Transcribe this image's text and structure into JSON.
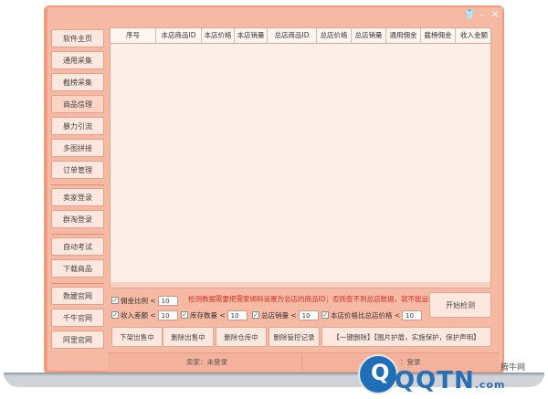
{
  "window": {
    "controls": [
      "👕",
      "–",
      "✕"
    ]
  },
  "sidebar": {
    "group1": [
      "软件主页",
      "通用采集",
      "截榜采集",
      "商品信理",
      "暴力引流",
      "多图拼接",
      "订单管理"
    ],
    "group2": [
      "卖家登录",
      "群淘登录"
    ],
    "group3": [
      "自动考试",
      "下载商品"
    ],
    "group4": [
      "数媛官网",
      "千牛官网",
      "阿里官网"
    ]
  },
  "table": {
    "columns": [
      "序号",
      "本店商品ID",
      "本店价格",
      "本店销量",
      "总店商品ID",
      "总店价格",
      "总店销量",
      "通用佣金",
      "截榜佣金",
      "收入金额"
    ]
  },
  "filters": {
    "row1": [
      {
        "label": "佣金比例 <",
        "value": "10"
      }
    ],
    "notice": "检测数据需要把需家绑码设置为总店的商品ID；否则查不到总店数据，就不能运行！",
    "row2": [
      {
        "label": "收入差额 <",
        "value": "10"
      },
      {
        "label": "库存数量 <",
        "value": "10"
      },
      {
        "label": "总店销量 <",
        "value": "10"
      },
      {
        "label": "本店价格比总店价格 <",
        "value": "10"
      }
    ]
  },
  "buttons": {
    "start": "开始检测",
    "actions": [
      "下架出售中",
      "删除出售中",
      "删除仓库中",
      "删除管控记录",
      "【一键删除】【图片护盾，实施保护，保护声明】"
    ]
  },
  "status": {
    "seller": "卖家：未登录",
    "right": "：登录"
  },
  "watermark": {
    "logo": "Q",
    "text": "QQTN",
    "suffix": ".com",
    "sub": "腾牛网"
  }
}
